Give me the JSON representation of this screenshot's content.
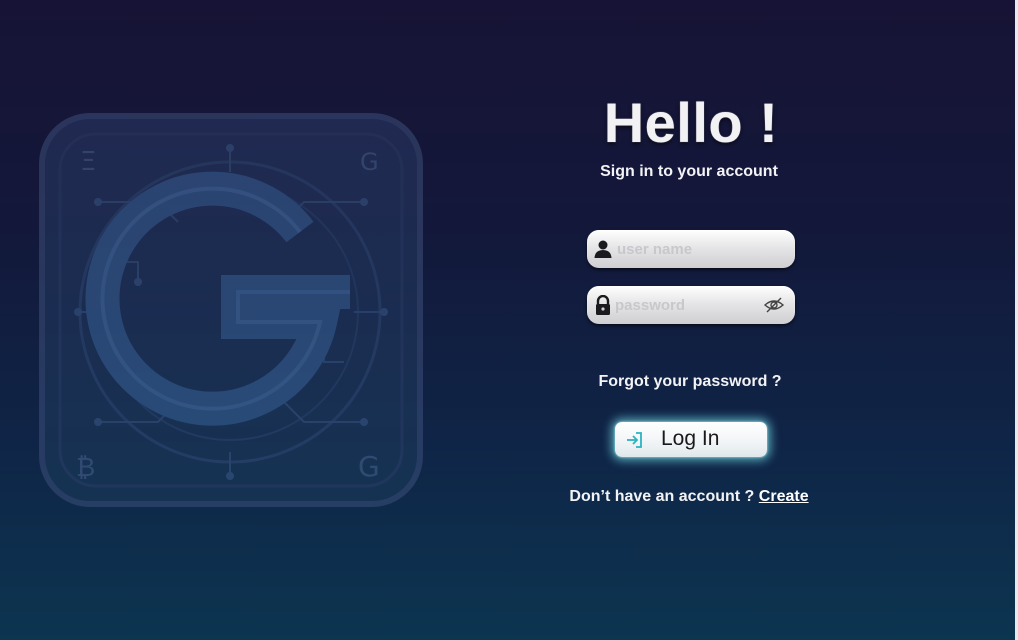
{
  "login": {
    "title": "Hello !",
    "subtitle": "Sign in to your account",
    "username": {
      "placeholder": "user name",
      "value": ""
    },
    "password": {
      "placeholder": "password",
      "value": ""
    },
    "forgot_text": "Forgot your password ?",
    "login_label": "Log In",
    "signup_prompt": "Don’t  have an account ?",
    "signup_link": "Create"
  },
  "icons": {
    "username": "user-icon",
    "password": "lock-icon",
    "toggle": "eye-slash-icon",
    "login": "sign-in-icon",
    "logo": "crypto-g-logo"
  },
  "colors": {
    "background_top": "#171336",
    "background_bottom": "#0c3550",
    "button_glow": "#78e1eb",
    "text": "#f3f3f5"
  }
}
